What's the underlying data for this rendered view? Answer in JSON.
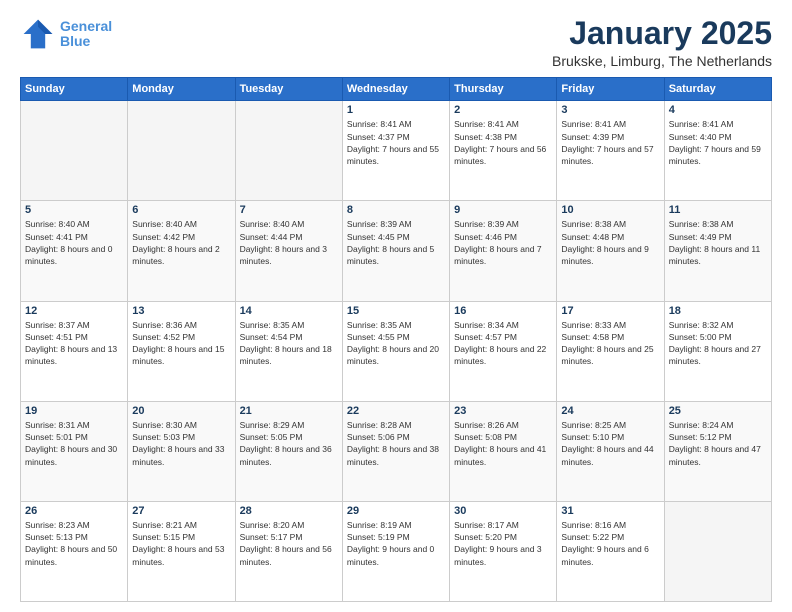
{
  "logo": {
    "line1": "General",
    "line2": "Blue"
  },
  "title": "January 2025",
  "location": "Brukske, Limburg, The Netherlands",
  "weekdays": [
    "Sunday",
    "Monday",
    "Tuesday",
    "Wednesday",
    "Thursday",
    "Friday",
    "Saturday"
  ],
  "weeks": [
    [
      {
        "day": "",
        "empty": true
      },
      {
        "day": "",
        "empty": true
      },
      {
        "day": "",
        "empty": true
      },
      {
        "day": "1",
        "sunrise": "8:41 AM",
        "sunset": "4:37 PM",
        "daylight": "7 hours and 55 minutes."
      },
      {
        "day": "2",
        "sunrise": "8:41 AM",
        "sunset": "4:38 PM",
        "daylight": "7 hours and 56 minutes."
      },
      {
        "day": "3",
        "sunrise": "8:41 AM",
        "sunset": "4:39 PM",
        "daylight": "7 hours and 57 minutes."
      },
      {
        "day": "4",
        "sunrise": "8:41 AM",
        "sunset": "4:40 PM",
        "daylight": "7 hours and 59 minutes."
      }
    ],
    [
      {
        "day": "5",
        "sunrise": "8:40 AM",
        "sunset": "4:41 PM",
        "daylight": "8 hours and 0 minutes."
      },
      {
        "day": "6",
        "sunrise": "8:40 AM",
        "sunset": "4:42 PM",
        "daylight": "8 hours and 2 minutes."
      },
      {
        "day": "7",
        "sunrise": "8:40 AM",
        "sunset": "4:44 PM",
        "daylight": "8 hours and 3 minutes."
      },
      {
        "day": "8",
        "sunrise": "8:39 AM",
        "sunset": "4:45 PM",
        "daylight": "8 hours and 5 minutes."
      },
      {
        "day": "9",
        "sunrise": "8:39 AM",
        "sunset": "4:46 PM",
        "daylight": "8 hours and 7 minutes."
      },
      {
        "day": "10",
        "sunrise": "8:38 AM",
        "sunset": "4:48 PM",
        "daylight": "8 hours and 9 minutes."
      },
      {
        "day": "11",
        "sunrise": "8:38 AM",
        "sunset": "4:49 PM",
        "daylight": "8 hours and 11 minutes."
      }
    ],
    [
      {
        "day": "12",
        "sunrise": "8:37 AM",
        "sunset": "4:51 PM",
        "daylight": "8 hours and 13 minutes."
      },
      {
        "day": "13",
        "sunrise": "8:36 AM",
        "sunset": "4:52 PM",
        "daylight": "8 hours and 15 minutes."
      },
      {
        "day": "14",
        "sunrise": "8:35 AM",
        "sunset": "4:54 PM",
        "daylight": "8 hours and 18 minutes."
      },
      {
        "day": "15",
        "sunrise": "8:35 AM",
        "sunset": "4:55 PM",
        "daylight": "8 hours and 20 minutes."
      },
      {
        "day": "16",
        "sunrise": "8:34 AM",
        "sunset": "4:57 PM",
        "daylight": "8 hours and 22 minutes."
      },
      {
        "day": "17",
        "sunrise": "8:33 AM",
        "sunset": "4:58 PM",
        "daylight": "8 hours and 25 minutes."
      },
      {
        "day": "18",
        "sunrise": "8:32 AM",
        "sunset": "5:00 PM",
        "daylight": "8 hours and 27 minutes."
      }
    ],
    [
      {
        "day": "19",
        "sunrise": "8:31 AM",
        "sunset": "5:01 PM",
        "daylight": "8 hours and 30 minutes."
      },
      {
        "day": "20",
        "sunrise": "8:30 AM",
        "sunset": "5:03 PM",
        "daylight": "8 hours and 33 minutes."
      },
      {
        "day": "21",
        "sunrise": "8:29 AM",
        "sunset": "5:05 PM",
        "daylight": "8 hours and 36 minutes."
      },
      {
        "day": "22",
        "sunrise": "8:28 AM",
        "sunset": "5:06 PM",
        "daylight": "8 hours and 38 minutes."
      },
      {
        "day": "23",
        "sunrise": "8:26 AM",
        "sunset": "5:08 PM",
        "daylight": "8 hours and 41 minutes."
      },
      {
        "day": "24",
        "sunrise": "8:25 AM",
        "sunset": "5:10 PM",
        "daylight": "8 hours and 44 minutes."
      },
      {
        "day": "25",
        "sunrise": "8:24 AM",
        "sunset": "5:12 PM",
        "daylight": "8 hours and 47 minutes."
      }
    ],
    [
      {
        "day": "26",
        "sunrise": "8:23 AM",
        "sunset": "5:13 PM",
        "daylight": "8 hours and 50 minutes."
      },
      {
        "day": "27",
        "sunrise": "8:21 AM",
        "sunset": "5:15 PM",
        "daylight": "8 hours and 53 minutes."
      },
      {
        "day": "28",
        "sunrise": "8:20 AM",
        "sunset": "5:17 PM",
        "daylight": "8 hours and 56 minutes."
      },
      {
        "day": "29",
        "sunrise": "8:19 AM",
        "sunset": "5:19 PM",
        "daylight": "9 hours and 0 minutes."
      },
      {
        "day": "30",
        "sunrise": "8:17 AM",
        "sunset": "5:20 PM",
        "daylight": "9 hours and 3 minutes."
      },
      {
        "day": "31",
        "sunrise": "8:16 AM",
        "sunset": "5:22 PM",
        "daylight": "9 hours and 6 minutes."
      },
      {
        "day": "",
        "empty": true
      }
    ]
  ]
}
